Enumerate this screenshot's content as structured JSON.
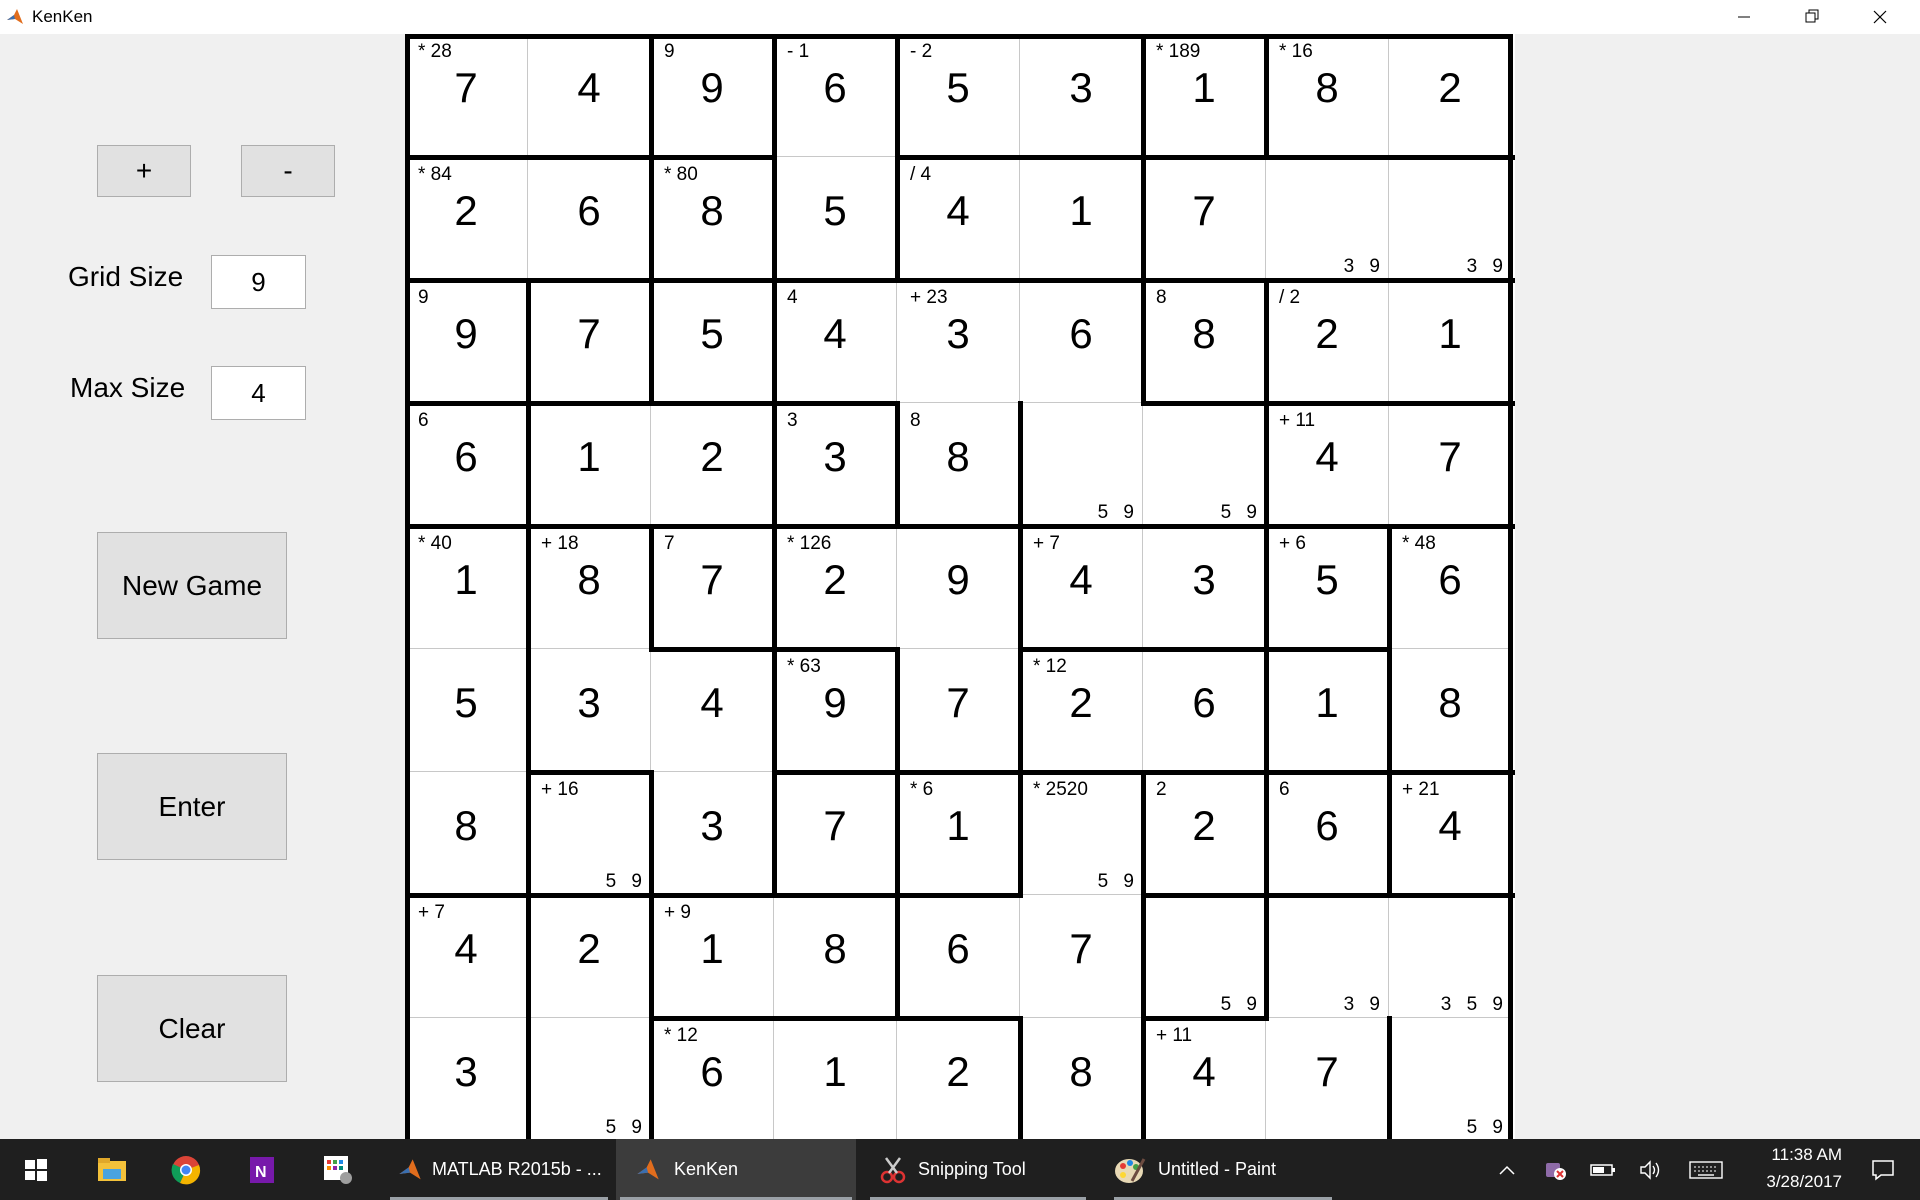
{
  "window": {
    "title": "KenKen",
    "controls": [
      "minimize",
      "restore",
      "close"
    ]
  },
  "left_panel": {
    "increase_label": "+",
    "decrease_label": "-",
    "grid_size_label": "Grid Size",
    "grid_size_value": "9",
    "max_size_label": "Max Size",
    "max_size_value": "4",
    "new_game_label": "New Game",
    "enter_label": "Enter",
    "clear_label": "Clear"
  },
  "board": {
    "size": 9,
    "values": [
      [
        "7",
        "4",
        "9",
        "6",
        "5",
        "3",
        "1",
        "8",
        "2"
      ],
      [
        "2",
        "6",
        "8",
        "5",
        "4",
        "1",
        "7",
        "",
        ""
      ],
      [
        "9",
        "7",
        "5",
        "4",
        "3",
        "6",
        "8",
        "2",
        "1"
      ],
      [
        "6",
        "1",
        "2",
        "3",
        "8",
        "",
        "",
        "4",
        "7"
      ],
      [
        "1",
        "8",
        "7",
        "2",
        "9",
        "4",
        "3",
        "5",
        "6"
      ],
      [
        "5",
        "3",
        "4",
        "9",
        "7",
        "2",
        "6",
        "1",
        "8"
      ],
      [
        "8",
        "",
        "3",
        "7",
        "1",
        "",
        "2",
        "6",
        "4"
      ],
      [
        "4",
        "2",
        "1",
        "8",
        "6",
        "7",
        "",
        "",
        ""
      ],
      [
        "3",
        "",
        "6",
        "1",
        "2",
        "8",
        "4",
        "7",
        ""
      ]
    ],
    "cage_labels": [
      [
        "* 28",
        "",
        "9",
        "- 1",
        "- 2",
        "",
        "* 189",
        "* 16",
        ""
      ],
      [
        "* 84",
        "",
        "* 80",
        "",
        "/ 4",
        "",
        "",
        "",
        ""
      ],
      [
        "9",
        "",
        "",
        "4",
        "+ 23",
        "",
        "8",
        "/ 2",
        ""
      ],
      [
        "6",
        "",
        "",
        "3",
        "8",
        "",
        "",
        "+ 11",
        ""
      ],
      [
        "* 40",
        "+ 18",
        "7",
        "* 126",
        "",
        "+ 7",
        "",
        "+ 6",
        "* 48"
      ],
      [
        "",
        "",
        "",
        "* 63",
        "",
        "* 12",
        "",
        "",
        ""
      ],
      [
        "",
        "+ 16",
        "",
        "",
        "* 6",
        "* 2520",
        "2",
        "6",
        "+ 21"
      ],
      [
        "+ 7",
        "",
        "+ 9",
        "",
        "",
        "",
        "",
        "",
        ""
      ],
      [
        "",
        "",
        "* 12",
        "",
        "",
        "",
        "+ 11",
        "",
        ""
      ]
    ],
    "candidates": [
      [
        "",
        "",
        "",
        "",
        "",
        "",
        "",
        "",
        ""
      ],
      [
        "",
        "",
        "",
        "",
        "",
        "",
        "",
        "3 9",
        "3 9"
      ],
      [
        "",
        "",
        "",
        "",
        "",
        "",
        "",
        "",
        ""
      ],
      [
        "",
        "",
        "",
        "",
        "",
        "5 9",
        "5 9",
        "",
        ""
      ],
      [
        "",
        "",
        "",
        "",
        "",
        "",
        "",
        "",
        ""
      ],
      [
        "",
        "",
        "",
        "",
        "",
        "",
        "",
        "",
        ""
      ],
      [
        "",
        "5 9",
        "",
        "",
        "",
        "5 9",
        "",
        "",
        ""
      ],
      [
        "",
        "",
        "",
        "",
        "",
        "",
        "5 9",
        "3 9",
        "3 5 9"
      ],
      [
        "",
        "5 9",
        "",
        "",
        "",
        "",
        "",
        "",
        "5 9"
      ]
    ]
  },
  "taskbar": {
    "apps": [
      {
        "label": "",
        "icon": "windows-start-icon"
      },
      {
        "label": "",
        "icon": "file-explorer-icon"
      },
      {
        "label": "",
        "icon": "chrome-icon"
      },
      {
        "label": "",
        "icon": "onenote-icon"
      },
      {
        "label": "",
        "icon": "app-grid-icon"
      },
      {
        "label": "MATLAB R2015b - ...",
        "icon": "matlab-icon"
      },
      {
        "label": "KenKen",
        "icon": "kenken-icon"
      },
      {
        "label": "Snipping Tool",
        "icon": "snipping-tool-icon"
      },
      {
        "label": "Untitled - Paint",
        "icon": "paint-icon"
      }
    ],
    "time": "11:38 AM",
    "date": "3/28/2017"
  }
}
